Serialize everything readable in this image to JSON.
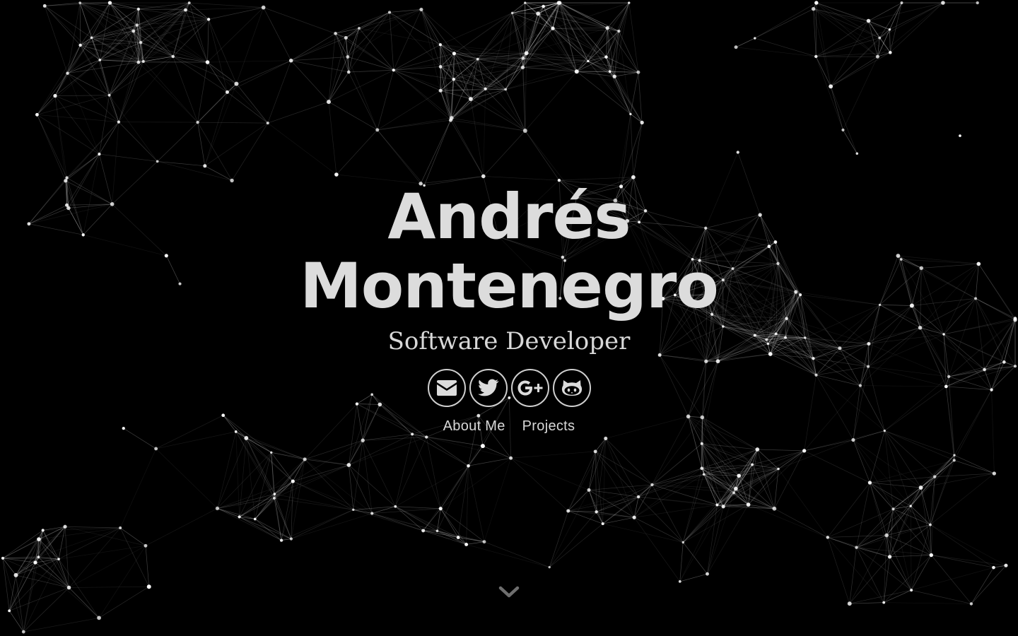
{
  "hero": {
    "name_line1": "Andrés",
    "name_line2": "Montenegro",
    "subtitle": "Software Developer"
  },
  "socials": [
    {
      "icon": "envelope-icon"
    },
    {
      "icon": "twitter-icon"
    },
    {
      "icon": "google-plus-icon"
    },
    {
      "icon": "github-icon"
    }
  ],
  "nav": {
    "about_label": "About Me",
    "projects_label": "Projects"
  },
  "scroll": {
    "icon": "chevron-down-icon"
  },
  "colors": {
    "background": "#000000",
    "text": "#dcdcdc",
    "network_line": "#ffffff",
    "network_node": "#ffffff"
  }
}
